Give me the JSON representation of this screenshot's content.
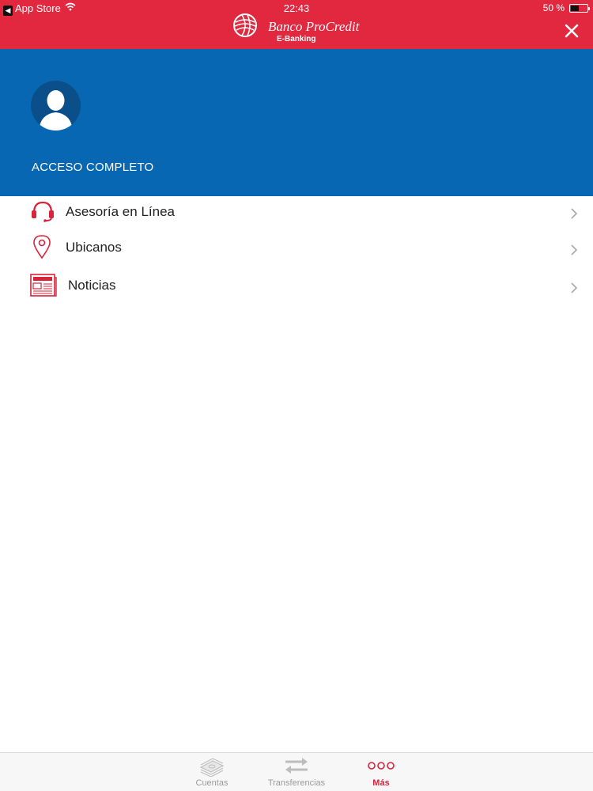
{
  "status_bar": {
    "back_app": "App Store",
    "time": "22:43",
    "battery_text": "50 %",
    "battery_level": 0.5
  },
  "header": {
    "brand_name": "Banco ProCredit",
    "brand_sub": "E-Banking",
    "close_icon": "close-icon",
    "background_color": "#e1283f"
  },
  "profile": {
    "access_label": "ACCESO COMPLETO",
    "avatar_icon": "user-silhouette-icon",
    "background_color": "#0767b2"
  },
  "menu": {
    "items": [
      {
        "label": "Asesoría en Línea",
        "icon": "headset-icon"
      },
      {
        "label": "Ubicanos",
        "icon": "location-pin-icon"
      },
      {
        "label": "Noticias",
        "icon": "newspaper-icon"
      }
    ]
  },
  "tabbar": {
    "tabs": [
      {
        "label": "Cuentas",
        "icon": "money-stack-icon",
        "active": false
      },
      {
        "label": "Transferencias",
        "icon": "transfer-arrows-icon",
        "active": false
      },
      {
        "label": "Más",
        "icon": "more-dots-icon",
        "active": true
      }
    ],
    "active_color": "#d8233a"
  }
}
